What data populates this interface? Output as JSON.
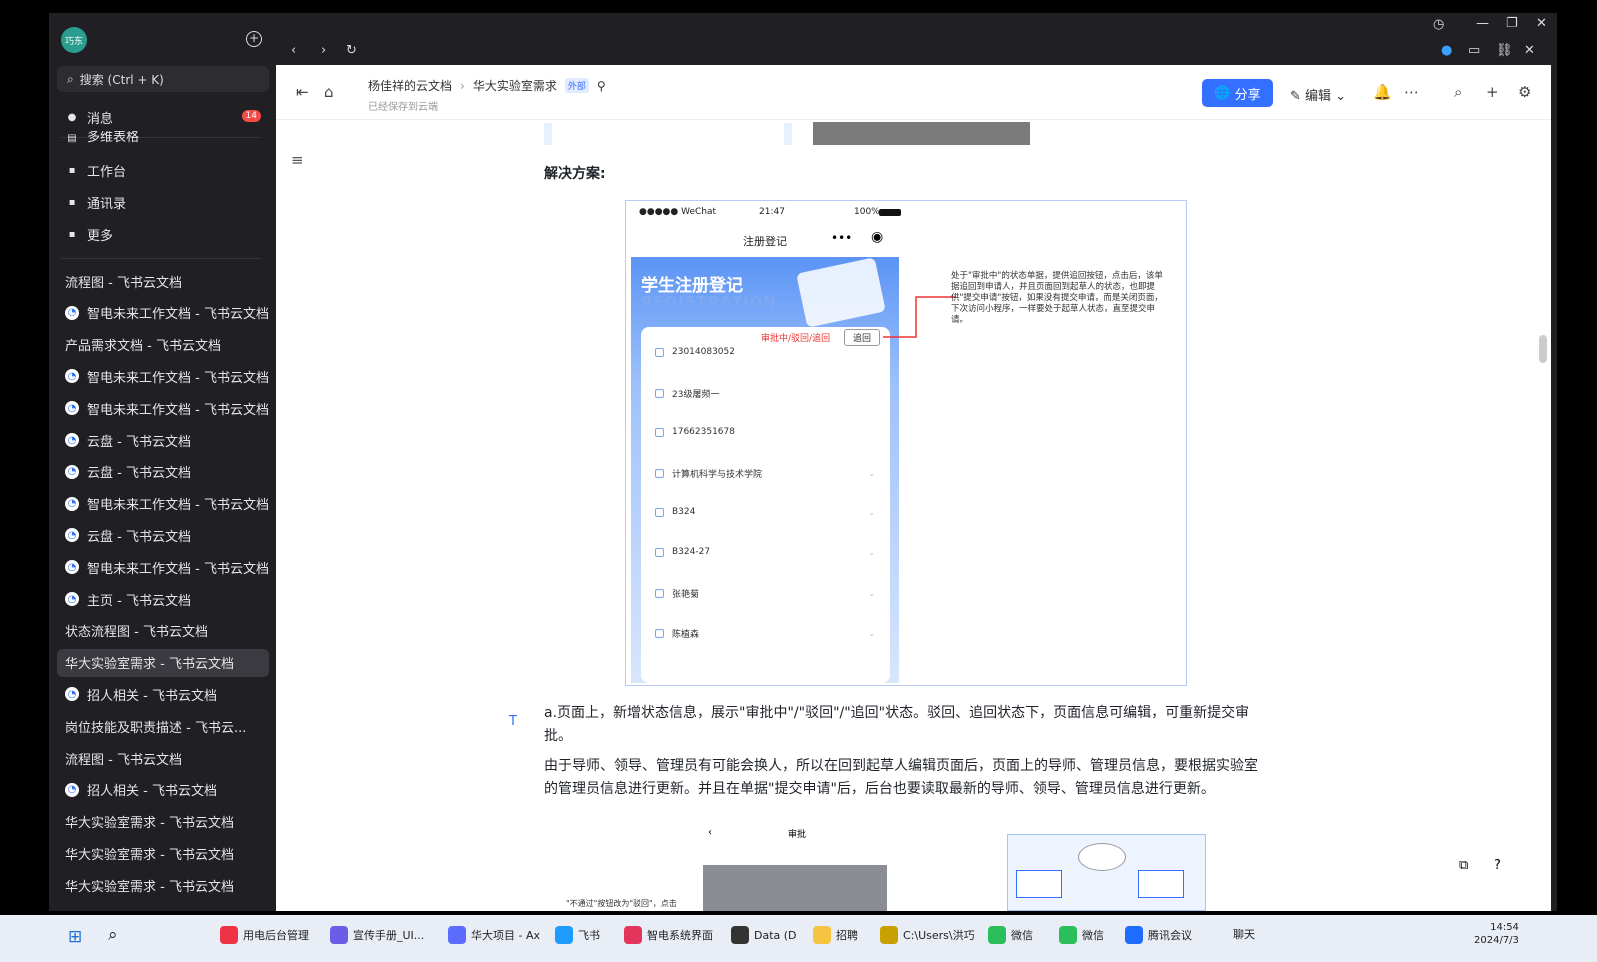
{
  "sidebar": {
    "avatar": "巧东",
    "search_placeholder": "搜索 (Ctrl + K)",
    "messages": {
      "label": "消息",
      "badge": "14"
    },
    "partial_item": "多维表格",
    "nav": [
      {
        "label": "工作台",
        "icon": "grid-icon"
      },
      {
        "label": "通讯录",
        "icon": "contacts-icon"
      },
      {
        "label": "更多",
        "icon": "more-apps-icon"
      }
    ],
    "docs": [
      {
        "label": "流程图 - 飞书云文档",
        "type": "doc"
      },
      {
        "label": "智电未来工作文档 - 飞书云文档",
        "type": "wiki"
      },
      {
        "label": "产品需求文档 - 飞书云文档",
        "type": "doc"
      },
      {
        "label": "智电未来工作文档 - 飞书云文档",
        "type": "wiki"
      },
      {
        "label": "智电未来工作文档 - 飞书云文档",
        "type": "wiki"
      },
      {
        "label": "云盘 - 飞书云文档",
        "type": "wiki"
      },
      {
        "label": "云盘 - 飞书云文档",
        "type": "wiki"
      },
      {
        "label": "智电未来工作文档 - 飞书云文档",
        "type": "wiki"
      },
      {
        "label": "云盘 - 飞书云文档",
        "type": "wiki"
      },
      {
        "label": "智电未来工作文档 - 飞书云文档",
        "type": "wiki"
      },
      {
        "label": "主页 - 飞书云文档",
        "type": "wiki"
      },
      {
        "label": "状态流程图 - 飞书云文档",
        "type": "doc"
      },
      {
        "label": "华大实验室需求 - 飞书云文档",
        "type": "doc",
        "active": true
      },
      {
        "label": "招人相关 - 飞书云文档",
        "type": "wiki"
      },
      {
        "label": "岗位技能及职责描述 - 飞书云...",
        "type": "doc"
      },
      {
        "label": "流程图 - 飞书云文档",
        "type": "doc"
      },
      {
        "label": "招人相关 - 飞书云文档",
        "type": "wiki"
      },
      {
        "label": "华大实验室需求 - 飞书云文档",
        "type": "doc"
      },
      {
        "label": "华大实验室需求 - 飞书云文档",
        "type": "doc"
      },
      {
        "label": "华大实验室需求 - 飞书云文档",
        "type": "doc"
      }
    ]
  },
  "header": {
    "breadcrumb_root": "杨佳祥的云文档",
    "breadcrumb_current": "华大实验室需求",
    "tag": "外部",
    "saved": "已经保存到云端",
    "share": "分享",
    "edit": "编辑"
  },
  "content": {
    "solution_heading": "解决方案:",
    "phone": {
      "carrier": "●●●●● WeChat",
      "time": "21:47",
      "battery": "100%",
      "title": "注册登记",
      "banner_title": "学生注册登记",
      "banner_sub": "REGISTRATION",
      "status_label": "审批中/驳回/追回",
      "recall_button": "追回",
      "rows": [
        "23014083052",
        "23级屠频一",
        "17662351678",
        "计算机科学与技术学院",
        "B324",
        "B324-27",
        "张艳菊",
        "陈植森"
      ]
    },
    "annotation": "处于\"审批中\"的状态单据，提供追回按钮，点击后，该单据追回到申请人，并且页面回到起草人的状态，也即提供\"提交申请\"按钮，如果没有提交申请，而是关闭页面，下次访问小程序，一样要处于起草人状态，直至提交申请。",
    "para_a": "a.页面上，新增状态信息，展示\"审批中\"/\"驳回\"/\"追回\"状态。驳回、追回状态下，页面信息可编辑，可重新提交审批。",
    "para_b": "由于导师、领导、管理员有可能会换人，所以在回到起草人编辑页面后，页面上的导师、管理员信息，要根据实验室的管理员信息进行更新。并且在单据\"提交申请\"后，后台也要读取最新的导师、领导、管理员信息进行更新。",
    "lower_caption": "\"不通过\"按钮改为\"驳回\"，点击",
    "lower_title": "审批"
  },
  "taskbar": {
    "items": [
      "用电后台管理",
      "宣传手册_UI...",
      "华大项目 - Ax",
      "飞书",
      "智电系统界面",
      "Data (D",
      "招聘",
      "C:\\Users\\洪巧",
      "微信",
      "微信",
      "腾讯会议"
    ],
    "chat": "聊天",
    "time": "14:54",
    "date": "2024/7/3"
  }
}
